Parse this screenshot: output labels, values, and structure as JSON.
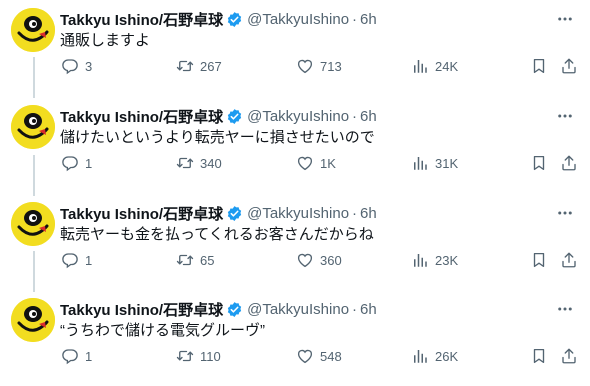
{
  "author": {
    "display_name": "Takkyu Ishino/石野卓球",
    "handle": "@TakkyuIshino",
    "separator": "·"
  },
  "icons": {
    "reply": "reply-icon",
    "retweet": "retweet-icon",
    "like": "heart-icon",
    "views": "views-chart-icon",
    "bookmark": "bookmark-icon",
    "share": "share-icon",
    "more": "more-icon",
    "verified": "verified-badge-icon"
  },
  "colors": {
    "verified_blue": "#1d9bf0",
    "avatar_yellow": "#f2dd20",
    "muted_text": "#536471",
    "thread_line": "#cfd9de"
  },
  "tweets": [
    {
      "time": "6h",
      "text": "通販しますよ",
      "replies": "3",
      "retweets": "267",
      "likes": "713",
      "views": "24K"
    },
    {
      "time": "6h",
      "text": "儲けたいというより転売ヤーに損させたいので",
      "replies": "1",
      "retweets": "340",
      "likes": "1K",
      "views": "31K"
    },
    {
      "time": "6h",
      "text": "転売ヤーも金を払ってくれるお客さんだからね",
      "replies": "1",
      "retweets": "65",
      "likes": "360",
      "views": "23K"
    },
    {
      "time": "6h",
      "text": "“うちわで儲ける電気グルーヴ”",
      "replies": "1",
      "retweets": "110",
      "likes": "548",
      "views": "26K"
    }
  ]
}
